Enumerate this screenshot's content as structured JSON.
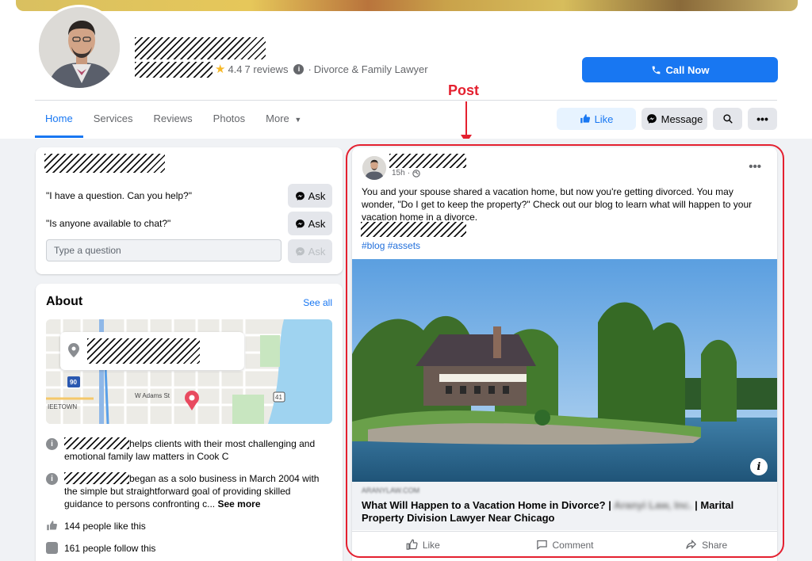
{
  "header": {
    "rating": "4.4",
    "reviews": "7 reviews",
    "category": "Divorce & Family Lawyer",
    "call_button": "Call Now",
    "annotation": "Post"
  },
  "tabs": [
    "Home",
    "Services",
    "Reviews",
    "Photos",
    "More"
  ],
  "actions_bar": {
    "like": "Like",
    "message": "Message"
  },
  "ask": {
    "questions": [
      "\"I have a question. Can you help?\"",
      "\"Is anyone available to chat?\""
    ],
    "ask_label": "Ask",
    "input_placeholder": "Type a question"
  },
  "about": {
    "title": "About",
    "see_all": "See all",
    "map_labels": {
      "street": "W Adams St",
      "highway1": "90",
      "highway2": "41",
      "area": "IEETOWN"
    },
    "desc1": "helps clients with their most challenging and emotional family law matters in Cook C",
    "desc2": "began as a solo business in March 2004 with the simple but straightforward goal of providing skilled guidance to persons confronting c...",
    "see_more": "See more",
    "likes": "144 people like this",
    "follows": "161 people follow this"
  },
  "post": {
    "time": "15h",
    "text": "You and your spouse shared a vacation home, but now you're getting divorced. You may wonder, \"Do I get to keep the property?\" Check out our blog to learn what will happen to your vacation home in a divorce.",
    "hashtags": "#blog #assets",
    "link_domain": "ARANYLAW.COM",
    "link_title_a": "What Will Happen to a Vacation Home in Divorce? |",
    "link_title_blur": "Aranyi Law, Inc.",
    "link_title_b": "| Marital Property Division Lawyer Near Chicago",
    "actions": {
      "like": "Like",
      "comment": "Comment",
      "share": "Share"
    }
  },
  "colors": {
    "accent": "#1877f2",
    "annotation": "#e4202f",
    "background": "#f0f2f5"
  }
}
